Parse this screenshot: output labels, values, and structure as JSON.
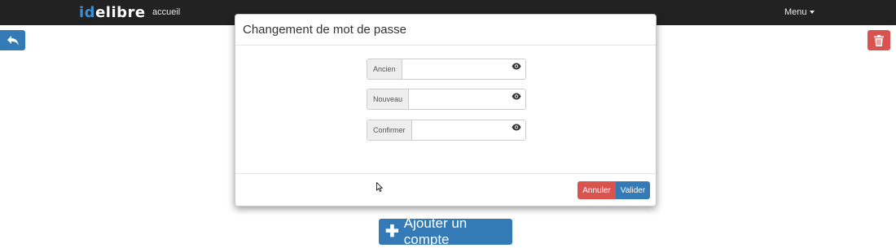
{
  "navbar": {
    "brand_prefix": "id",
    "brand_suffix": "elibre",
    "home_link": "accueil",
    "menu_label": "Menu",
    "background": "#222222",
    "brand_accent": "#3a8fd6"
  },
  "page": {
    "add_account_label": "Ajouter un compte",
    "back_icon": "reply-arrow-icon",
    "delete_icon": "trash-icon",
    "primary_color": "#337ab7",
    "danger_color": "#d9534f"
  },
  "modal": {
    "title": "Changement de mot de passe",
    "fields": [
      {
        "label": "Ancien",
        "value": "",
        "placeholder": ""
      },
      {
        "label": "Nouveau",
        "value": "",
        "placeholder": ""
      },
      {
        "label": "Confirmer",
        "value": "",
        "placeholder": ""
      }
    ],
    "toggle_icon": "eye-icon",
    "cancel_label": "Annuler",
    "submit_label": "Valider"
  }
}
